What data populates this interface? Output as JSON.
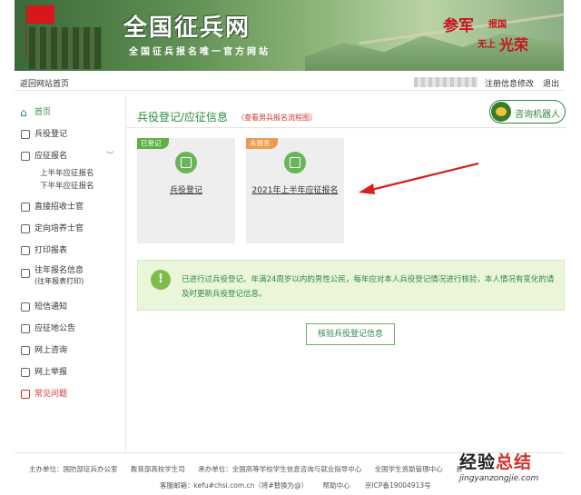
{
  "banner": {
    "title": "全国征兵网",
    "subtitle": "全国征兵报名唯一官方网站",
    "slogan_1": "参军",
    "slogan_2": "报国",
    "slogan_3": "无上",
    "slogan_4": "光荣"
  },
  "topbar": {
    "back_home": "返回网站首页",
    "register_edit": "注册信息修改",
    "logout": "退出"
  },
  "sidebar": {
    "items": [
      {
        "label": "首页",
        "icon": "home-icon"
      },
      {
        "label": "兵役登记",
        "icon": "form-icon"
      },
      {
        "label": "应征报名",
        "icon": "list-icon"
      },
      {
        "label": "直接招收士官",
        "icon": "card-icon"
      },
      {
        "label": "定向培养士官",
        "icon": "target-icon"
      },
      {
        "label": "打印报表",
        "icon": "print-icon"
      },
      {
        "label": "往年报名信息",
        "sub": "(往年报表打印)",
        "icon": "file-icon"
      },
      {
        "label": "短信通知",
        "icon": "message-icon"
      },
      {
        "label": "应征地公告",
        "icon": "notice-icon"
      },
      {
        "label": "网上咨询",
        "icon": "chat-icon"
      },
      {
        "label": "网上举报",
        "icon": "report-icon"
      },
      {
        "label": "常见问题",
        "icon": "question-icon"
      }
    ],
    "sub_items": [
      "上半年应征报名",
      "下半年应征报名"
    ]
  },
  "main": {
    "title": "兵役登记/应征信息",
    "flow_link": "（查看男兵报名流程图）",
    "robot_label": "咨询机器人",
    "cards": [
      {
        "tag": "已登记",
        "label": "兵役登记",
        "icon": "document-icon"
      },
      {
        "tag": "未报名",
        "label": "2021年上半年应征报名",
        "icon": "calendar-icon"
      }
    ],
    "notice": "已进行过兵役登记、年满24周岁以内的男性公民，每年应对本人兵役登记情况进行核验，本人情况有变化的请及时更新兵役登记信息。",
    "verify_button": "核验兵役登记信息"
  },
  "footer": {
    "row1": [
      "主办单位：国防部征兵办公室",
      "教育部高校学生司",
      "承办单位：全国高等学校学生信息咨询与就业指导中心",
      "全国学生资助管理中心",
      "系"
    ],
    "row2": [
      "客服邮箱：kefu#chsi.com.cn（将#替换为@）",
      "帮助中心",
      "京ICP备19004913号"
    ]
  },
  "watermark": {
    "text_a": "经验",
    "text_b": "总结",
    "url": "jingyanzongjie.com"
  },
  "colors": {
    "accent_green": "#2c8a3f",
    "tag_green": "#5fb246",
    "tag_orange": "#f09a4d",
    "alert_red": "#d0312d",
    "notice_bg": "#eaf5da"
  }
}
